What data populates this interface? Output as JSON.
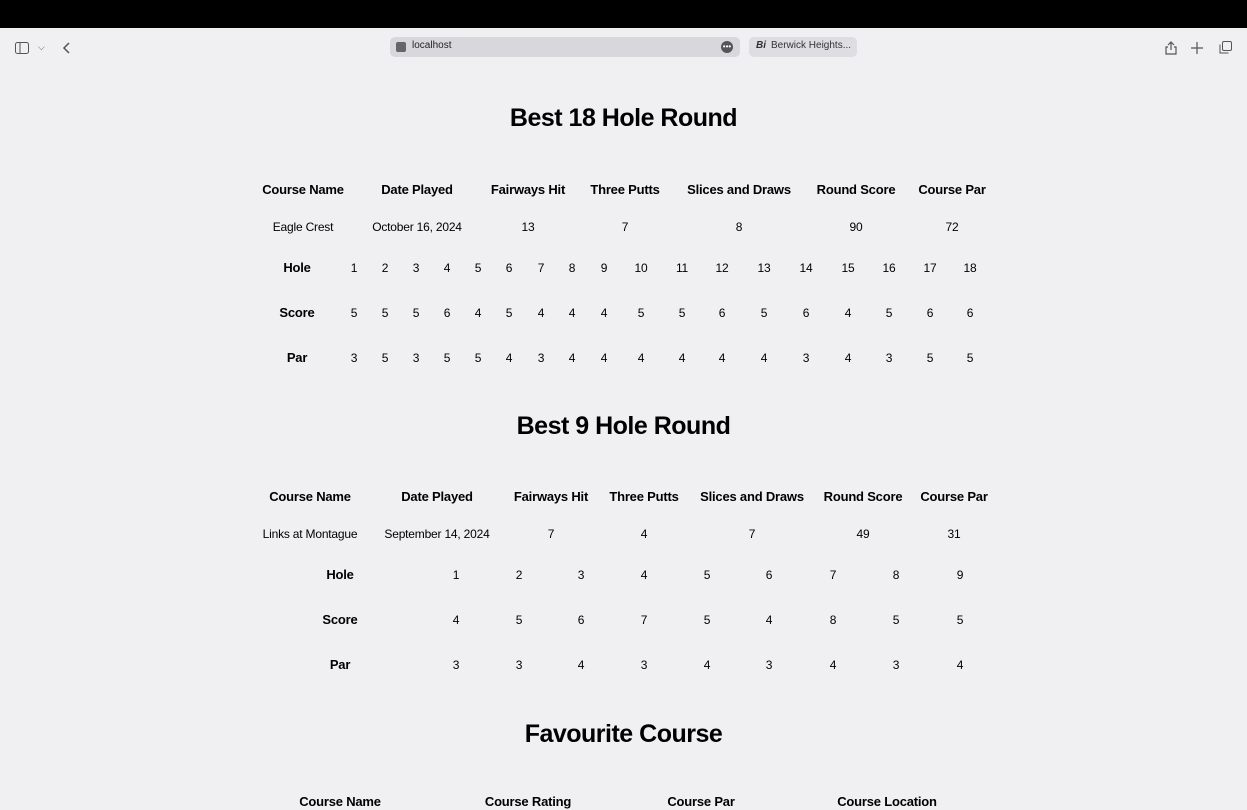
{
  "browser": {
    "url": "localhost",
    "tab_title": "Berwick Heights...",
    "tab_icon_text": "Bi"
  },
  "best18": {
    "title": "Best 18 Hole Round",
    "headers": [
      "Course Name",
      "Date Played",
      "Fairways Hit",
      "Three Putts",
      "Slices and Draws",
      "Round Score",
      "Course Par"
    ],
    "values": [
      "Eagle Crest",
      "October 16, 2024",
      "13",
      "7",
      "8",
      "90",
      "72"
    ],
    "row_labels": [
      "Hole",
      "Score",
      "Par"
    ],
    "holes": [
      "1",
      "2",
      "3",
      "4",
      "5",
      "6",
      "7",
      "8",
      "9",
      "10",
      "11",
      "12",
      "13",
      "14",
      "15",
      "16",
      "17",
      "18"
    ],
    "scores": [
      "5",
      "5",
      "5",
      "6",
      "4",
      "5",
      "4",
      "4",
      "4",
      "5",
      "5",
      "6",
      "5",
      "6",
      "4",
      "5",
      "6",
      "6"
    ],
    "pars": [
      "3",
      "5",
      "3",
      "5",
      "5",
      "4",
      "3",
      "4",
      "4",
      "4",
      "4",
      "4",
      "4",
      "3",
      "4",
      "3",
      "5",
      "5"
    ]
  },
  "best9": {
    "title": "Best 9 Hole Round",
    "headers": [
      "Course Name",
      "Date Played",
      "Fairways Hit",
      "Three Putts",
      "Slices and Draws",
      "Round Score",
      "Course Par"
    ],
    "values": [
      "Links at Montague",
      "September 14, 2024",
      "7",
      "4",
      "7",
      "49",
      "31"
    ],
    "row_labels": [
      "Hole",
      "Score",
      "Par"
    ],
    "holes": [
      "1",
      "2",
      "3",
      "4",
      "5",
      "6",
      "7",
      "8",
      "9"
    ],
    "scores": [
      "4",
      "5",
      "6",
      "7",
      "5",
      "4",
      "8",
      "5",
      "5"
    ],
    "pars": [
      "3",
      "3",
      "4",
      "3",
      "4",
      "3",
      "4",
      "3",
      "4"
    ]
  },
  "favourite": {
    "title": "Favourite Course",
    "headers": [
      "Course Name",
      "Course Rating",
      "Course Par",
      "Course Location"
    ]
  }
}
